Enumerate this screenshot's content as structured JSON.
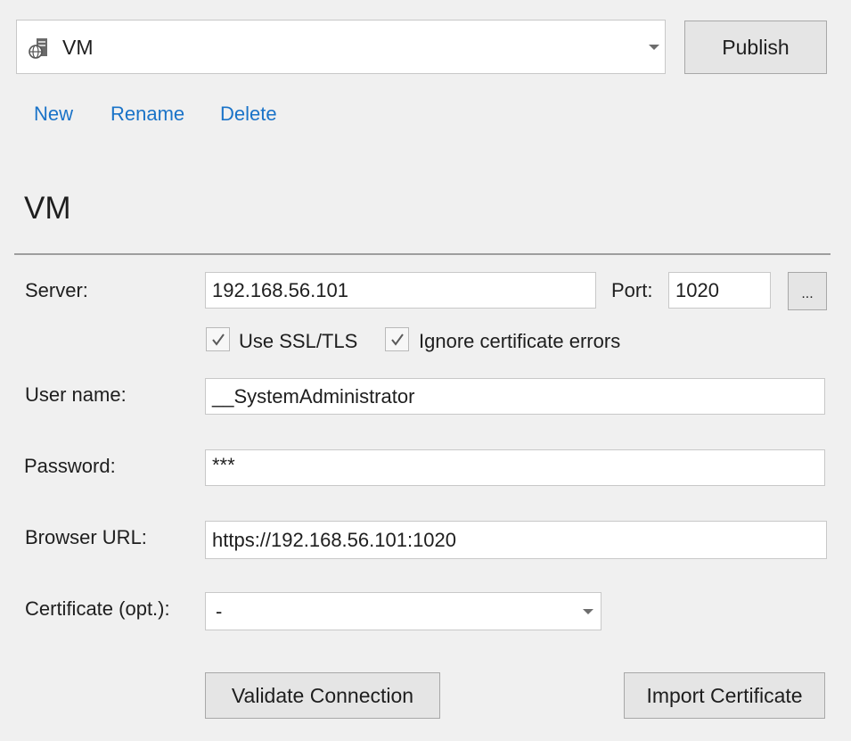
{
  "profile": {
    "selected": "VM",
    "icon": "server-globe-icon"
  },
  "publish_label": "Publish",
  "links": {
    "new": "New",
    "rename": "Rename",
    "delete": "Delete"
  },
  "section_title": "VM",
  "server": {
    "label": "Server:",
    "value": "192.168.56.101"
  },
  "port": {
    "label": "Port:",
    "value": "1020",
    "browse_label": "..."
  },
  "checkboxes": {
    "ssl": {
      "label": "Use SSL/TLS",
      "checked": true
    },
    "ignore_cert": {
      "label": "Ignore certificate errors",
      "checked": true
    }
  },
  "username": {
    "label": "User name:",
    "value": "__SystemAdministrator"
  },
  "password": {
    "label": "Password:",
    "value": "***"
  },
  "browser_url": {
    "label": "Browser URL:",
    "value": "https://192.168.56.101:1020"
  },
  "certificate": {
    "label": "Certificate (opt.):",
    "value": "-"
  },
  "buttons": {
    "validate": "Validate Connection",
    "import": "Import Certificate"
  },
  "colors": {
    "link": "#1a73c8",
    "background": "#f0f0f0",
    "button": "#e5e5e5"
  }
}
